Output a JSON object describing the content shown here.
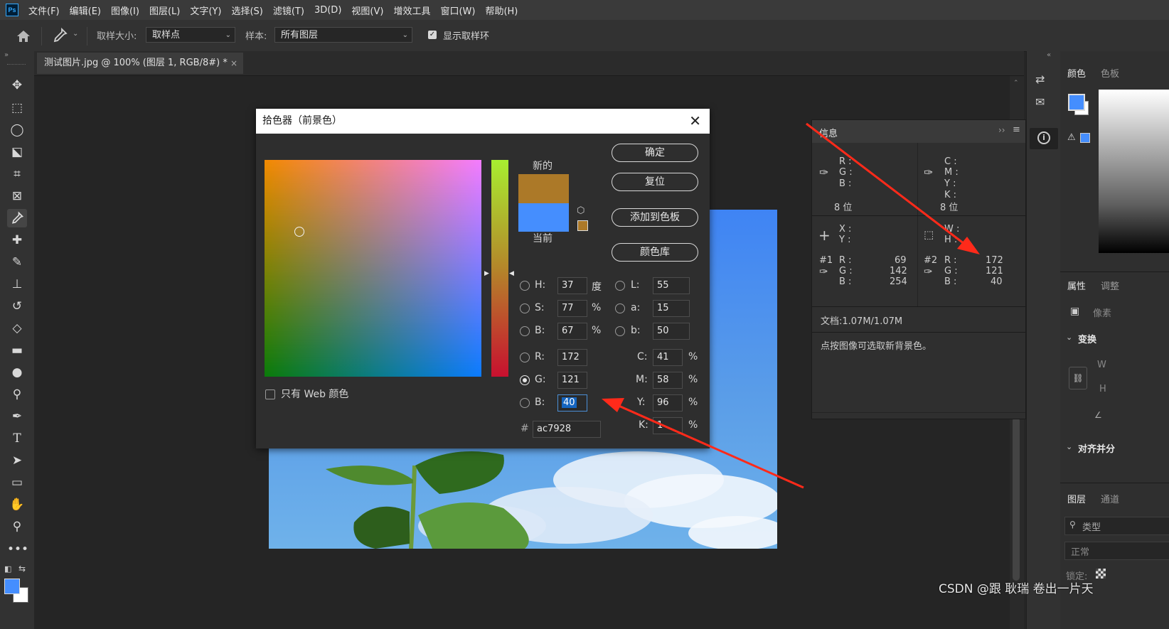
{
  "menubar": {
    "logo": "Ps",
    "items": [
      "文件(F)",
      "编辑(E)",
      "图像(I)",
      "图层(L)",
      "文字(Y)",
      "选择(S)",
      "滤镜(T)",
      "3D(D)",
      "视图(V)",
      "增效工具",
      "窗口(W)",
      "帮助(H)"
    ]
  },
  "options": {
    "sample_size_label": "取样大小:",
    "sample_size_value": "取样点",
    "sample_label": "样本:",
    "sample_value": "所有图层",
    "show_ring_label": "显示取样环"
  },
  "document": {
    "tab_title": "测试图片.jpg @ 100% (图层 1, RGB/8#) *"
  },
  "dialog": {
    "title": "拾色器（前景色）",
    "ok": "确定",
    "reset": "复位",
    "add_swatch": "添加到色板",
    "libraries": "颜色库",
    "new_label": "新的",
    "current_label": "当前",
    "web_only": "只有 Web 颜色",
    "new_color": "#ac7928",
    "current_color": "#458efe",
    "H": {
      "label": "H:",
      "value": "37",
      "unit": "度"
    },
    "S": {
      "label": "S:",
      "value": "77",
      "unit": "%"
    },
    "Bv": {
      "label": "B:",
      "value": "67",
      "unit": "%"
    },
    "R": {
      "label": "R:",
      "value": "172"
    },
    "G": {
      "label": "G:",
      "value": "121"
    },
    "Bl": {
      "label": "B:",
      "value": "40"
    },
    "L": {
      "label": "L:",
      "value": "55"
    },
    "a": {
      "label": "a:",
      "value": "15"
    },
    "b": {
      "label": "b:",
      "value": "50"
    },
    "C": {
      "label": "C:",
      "value": "41",
      "unit": "%"
    },
    "M": {
      "label": "M:",
      "value": "58",
      "unit": "%"
    },
    "Y": {
      "label": "Y:",
      "value": "96",
      "unit": "%"
    },
    "K": {
      "label": "K:",
      "value": "1",
      "unit": "%"
    },
    "hex_label": "#",
    "hex": "ac7928"
  },
  "info_panel": {
    "title": "信息",
    "rgb_labels": [
      "R :",
      "G :",
      "B :"
    ],
    "cmyk_labels": [
      "C :",
      "M :",
      "Y :",
      "K :"
    ],
    "bits1": "8 位",
    "bits2": "8 位",
    "xy_labels": [
      "X :",
      "Y :"
    ],
    "wh_labels": [
      "W :",
      "H :"
    ],
    "s1_label": "#1",
    "s1_values": [
      "69",
      "142",
      "254"
    ],
    "s2_label": "#2",
    "s2_values": [
      "172",
      "121",
      "40"
    ],
    "doc_size": "文档:1.07M/1.07M",
    "hint": "点按图像可选取新背景色。"
  },
  "right_panel": {
    "color_tab": "颜色",
    "swatch_tab": "色板",
    "properties_tab": "属性",
    "adjust_tab": "调整",
    "pixel_label": "像素",
    "transform": "变换",
    "w_label": "W",
    "h_label": "H",
    "align": "对齐并分",
    "layers_tab": "图层",
    "channels_tab": "通道",
    "kind": "类型",
    "blend": "正常",
    "lock": "锁定:"
  },
  "watermark": "CSDN @跟 耿瑞 卷出一片天"
}
